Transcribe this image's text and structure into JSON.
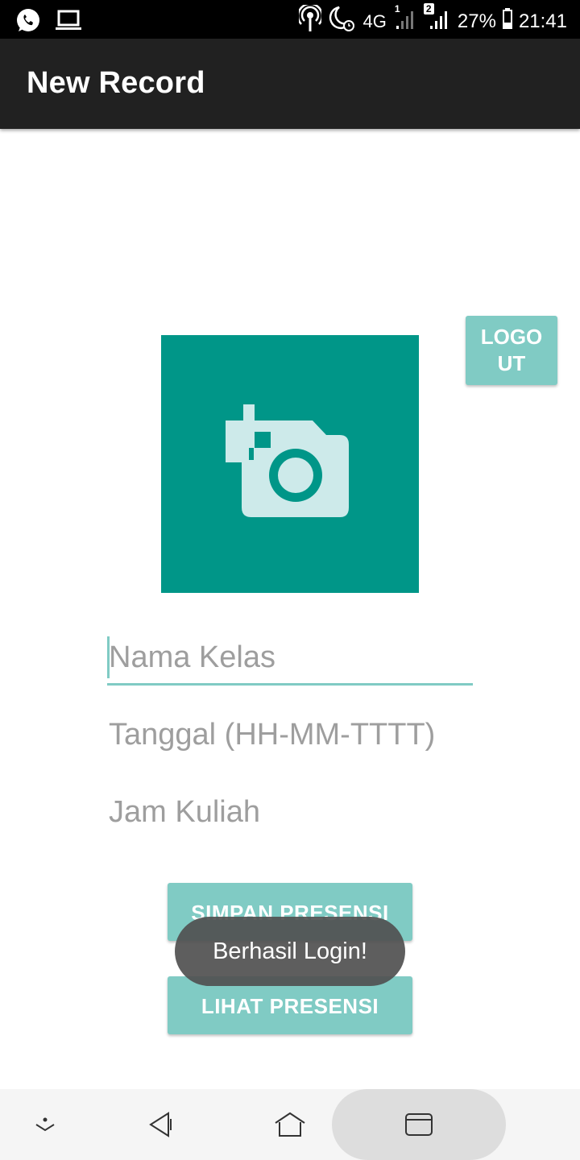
{
  "status_bar": {
    "notifications": [
      "whatsapp-icon",
      "laptop-icon"
    ],
    "indicators": [
      "hotspot-icon",
      "night-alarm-icon"
    ],
    "network": "4G",
    "sim1_label": "1",
    "sim2_label": "2",
    "battery": "27%",
    "time": "21:41"
  },
  "app_bar": {
    "title": "New Record"
  },
  "logout_button": {
    "label": "LOGO UT"
  },
  "photo": {
    "icon": "add-a-photo-icon",
    "background": "#009688",
    "icon_color": "#cdeaea"
  },
  "form": {
    "nama_kelas": {
      "placeholder": "Nama Kelas"
    },
    "tanggal": {
      "placeholder": "Tanggal (HH-MM-TTTT)"
    },
    "jam_kuliah": {
      "placeholder": "Jam Kuliah"
    }
  },
  "buttons": {
    "simpan": "SIMPAN PRESENSI",
    "lihat": "LIHAT PRESENSI"
  },
  "toast": {
    "message": "Berhasil Login!"
  },
  "nav_bar": {
    "items": [
      "hide-keyboard-icon",
      "back-icon",
      "home-icon",
      "recents-icon"
    ]
  },
  "colors": {
    "accent": "#80cbc4",
    "primary": "#009688",
    "app_bar": "#212121"
  }
}
